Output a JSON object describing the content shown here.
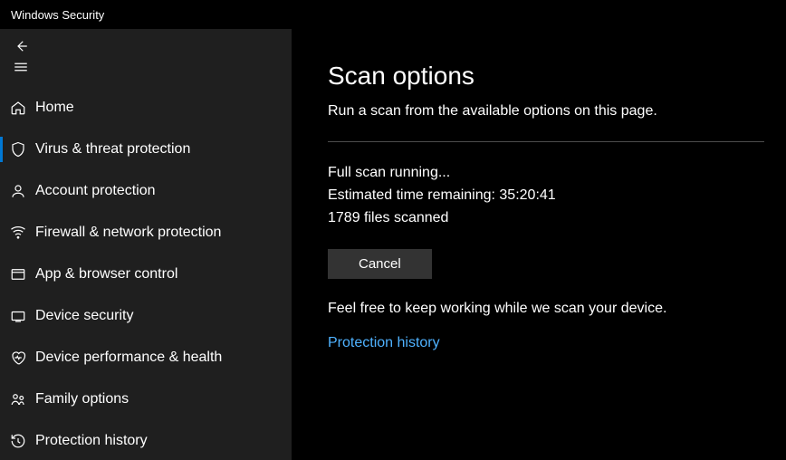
{
  "window": {
    "title": "Windows Security"
  },
  "sidebar": {
    "items": [
      {
        "label": "Home"
      },
      {
        "label": "Virus & threat protection"
      },
      {
        "label": "Account protection"
      },
      {
        "label": "Firewall & network protection"
      },
      {
        "label": "App & browser control"
      },
      {
        "label": "Device security"
      },
      {
        "label": "Device performance & health"
      },
      {
        "label": "Family options"
      },
      {
        "label": "Protection history"
      }
    ]
  },
  "main": {
    "title": "Scan options",
    "description": "Run a scan from the available options on this page.",
    "status_running": "Full scan running...",
    "status_time": "Estimated time remaining: 35:20:41",
    "status_files": "1789 files scanned",
    "cancel_label": "Cancel",
    "info_text": "Feel free to keep working while we scan your device.",
    "history_link": "Protection history"
  }
}
